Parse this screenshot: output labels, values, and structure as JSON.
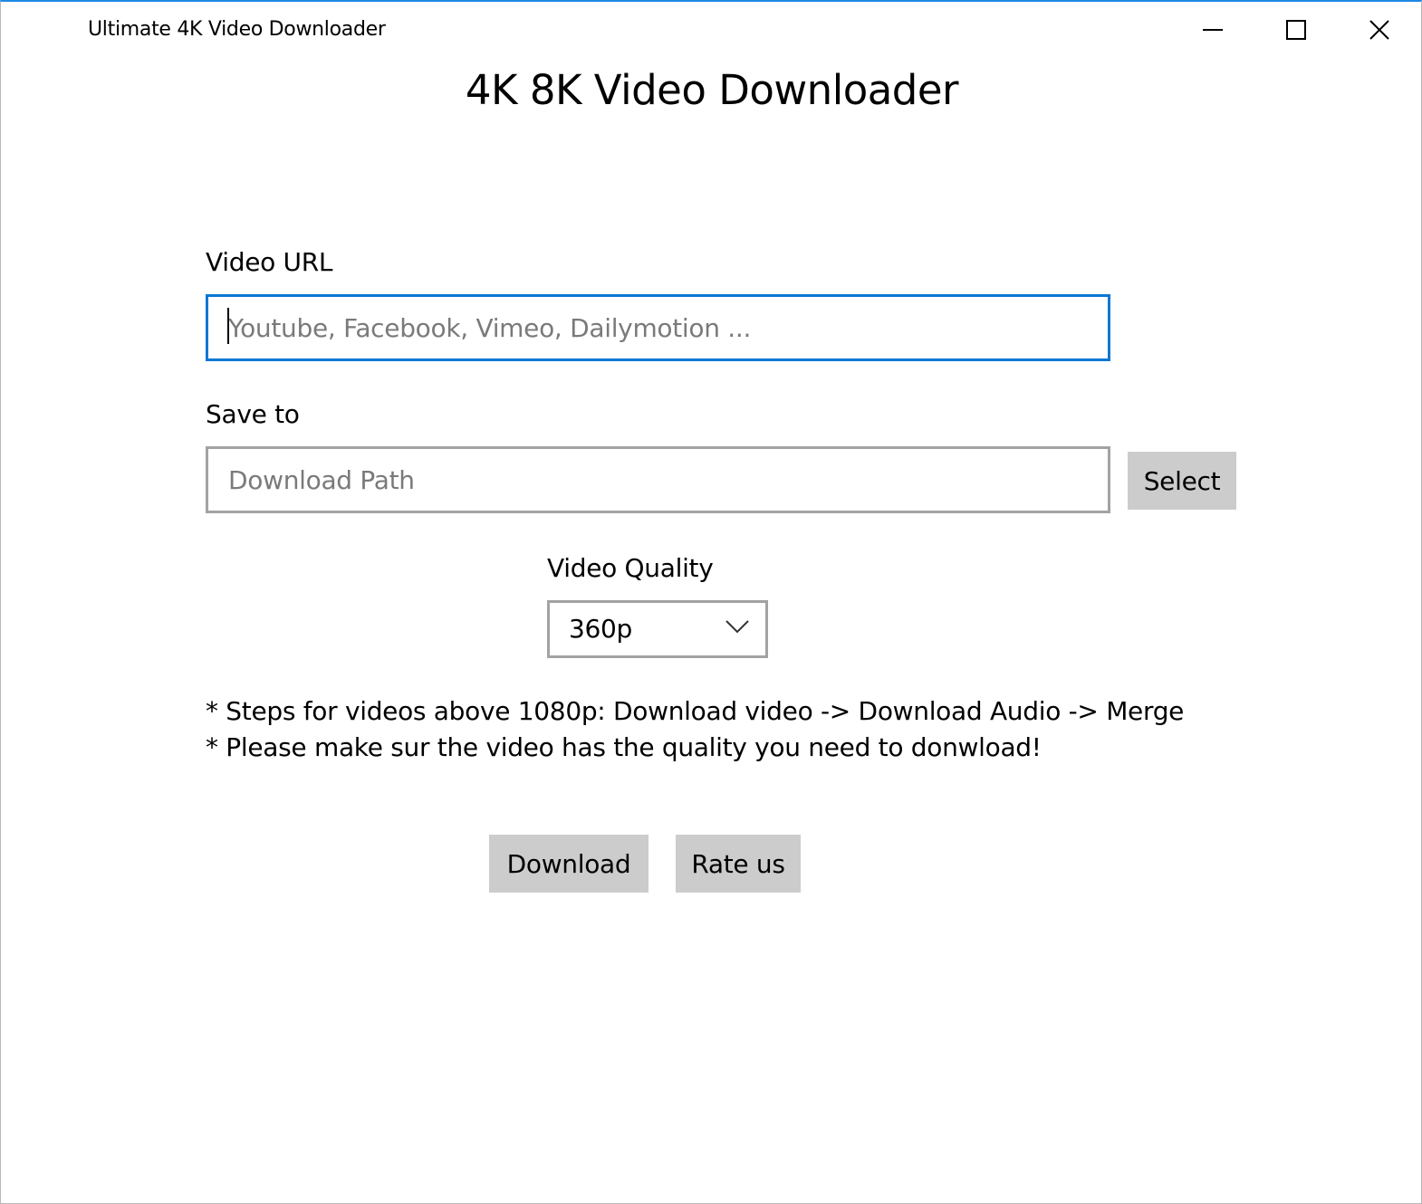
{
  "window": {
    "title": "Ultimate 4K Video Downloader",
    "controls": {
      "minimize_icon": "minimize-icon",
      "maximize_icon": "maximize-icon",
      "close_icon": "close-icon"
    },
    "accent_color": "#0a78d4"
  },
  "main": {
    "heading": "4K 8K Video Downloader",
    "video_url": {
      "label": "Video URL",
      "value": "",
      "placeholder": "Youtube, Facebook, Vimeo, Dailymotion ..."
    },
    "save_to": {
      "label": "Save to",
      "value": "",
      "placeholder": "Download Path",
      "select_label": "Select"
    },
    "quality": {
      "label": "Video Quality",
      "selected": "360p",
      "chevron_icon": "chevron-down-icon"
    },
    "notes": [
      "* Steps for videos above 1080p: Download video -> Download Audio -> Merge",
      "* Please make sur the video has the quality you need to donwload!"
    ],
    "actions": {
      "download_label": "Download",
      "rate_label": "Rate us"
    }
  }
}
